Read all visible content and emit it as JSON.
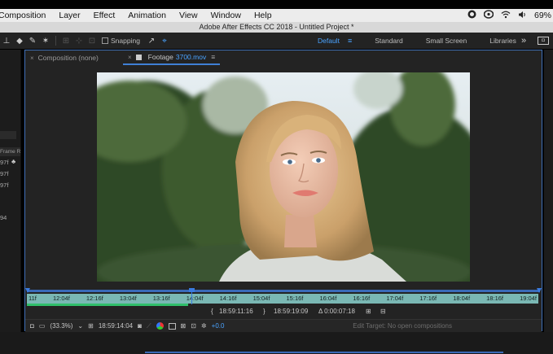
{
  "menubar": {
    "items": [
      "Composition",
      "Layer",
      "Effect",
      "Animation",
      "View",
      "Window",
      "Help"
    ],
    "status_icons": [
      "creative-cloud-icon",
      "sync-icon",
      "wifi-icon",
      "volume-icon"
    ],
    "battery": "69%"
  },
  "window": {
    "title": "Adobe After Effects CC 2018 - Untitled Project *"
  },
  "toolbar": {
    "snapping_label": "Snapping",
    "workspaces": [
      "Default",
      "Standard",
      "Small Screen",
      "Libraries"
    ],
    "active_workspace": "Default",
    "more_label": "»"
  },
  "leftpanel": {
    "column_header": "Frame Ra...",
    "rows": [
      "97f",
      "97f",
      "97f",
      "94"
    ]
  },
  "viewer": {
    "tabs": [
      {
        "prefix": "×",
        "label": "Composition (none)"
      },
      {
        "prefix": "×",
        "label": "Footage",
        "filename": "3700.mov",
        "menu": "≡"
      }
    ]
  },
  "ruler": {
    "ticks": [
      "11f",
      "12:04f",
      "12:16f",
      "13:04f",
      "13:16f",
      "14:04f",
      "14:16f",
      "15:04f",
      "15:16f",
      "16:04f",
      "16:16f",
      "17:04f",
      "17:16f",
      "18:04f",
      "18:16f",
      "19:04f"
    ]
  },
  "inout": {
    "in_time": "18:59:11:16",
    "out_time": "18:59:19:09",
    "duration": "Δ 0:00:07:18"
  },
  "controls": {
    "magnification": "(33.3%)",
    "current_time": "18:59:14:04",
    "exposure": "+0.0",
    "edit_target": "Edit Target: No open compositions"
  },
  "colors": {
    "accent": "#4aa3ff",
    "panel_border": "#3f6fb6",
    "ruler_bar": "#7ab8b4",
    "workarea": "#2fbf6a"
  }
}
